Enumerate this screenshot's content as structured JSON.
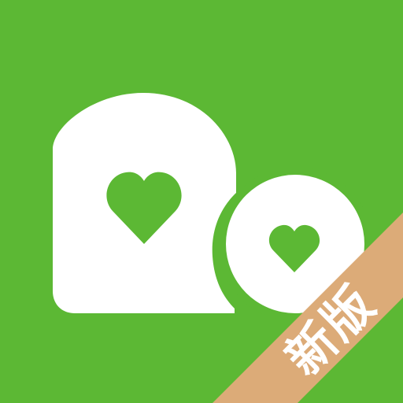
{
  "app_icon": {
    "badge_text": "新版",
    "icons": {
      "large_bubble": "speech-bubble-icon",
      "large_heart": "heart-icon",
      "small_bubble": "circle-bubble-icon",
      "small_heart": "heart-icon"
    },
    "colors": {
      "background": "#5cb834",
      "foreground": "#ffffff",
      "heart": "#5cb834",
      "ribbon": "#dcab78",
      "ribbon_text": "#ffffff"
    }
  }
}
